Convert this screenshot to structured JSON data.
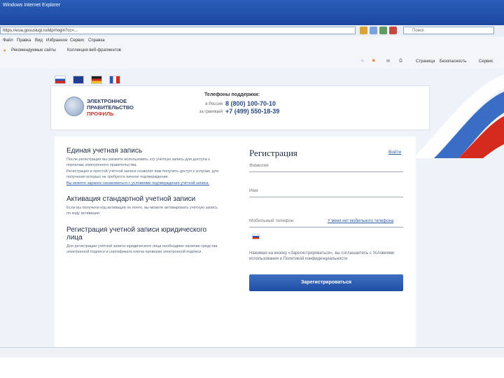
{
  "browser": {
    "title": "Windows Internet Explorer",
    "url": "https://esia.gosuslugi.ru/idp/rlogin?cc=...",
    "search_placeholder": "Поиск",
    "menu": [
      "Файл",
      "Правка",
      "Вид",
      "Избранное",
      "Сервис",
      "Справка"
    ],
    "favorites": [
      "Рекомендуемые сайты",
      "Коллекция веб-фрагментов"
    ],
    "commands": [
      "Страница",
      "Безопасность",
      "Сервис"
    ]
  },
  "header": {
    "languages": [
      "ru",
      "en",
      "de",
      "fr"
    ],
    "logo": [
      "ЭЛЕКТРОННОЕ",
      "ПРАВИТЕЛЬСТВО",
      "ПРОФИЛЬ"
    ],
    "support_title": "Телефоны поддержки:",
    "phone1_label": "в России",
    "phone1": "8 (800) 100-70-10",
    "phone2_label": "за границей",
    "phone2": "+7 (499) 550-18-39"
  },
  "left": {
    "section1_title": "Единая учетная запись",
    "section1_text": "После регистрации вы сможете использовать эту учётную запись для доступа к порталам электронного правительства.",
    "section1_text2": "Регистрация и простой учётной записи позволит вам получить доступ к услугам, для получения которых не требуется личное подтверждение.",
    "section1_link": "Вы можете заранее ознакомиться с условиями подтверждения учётной записи.",
    "section2_title": "Активация стандартной учетной записи",
    "section2_text": "Если вы получили код активации по почте, вы можете активировать учётную запись по коду активации.",
    "section3_title": "Регистрация учетной записи юридического лица",
    "section3_text": "Для регистрации учётной записи юридического лица необходимо наличие средства электронной подписи и сертификата ключа проверки электронной подписи."
  },
  "form": {
    "title": "Регистрация",
    "login_link": "Войти",
    "lastname_placeholder": "Фамилия",
    "firstname_placeholder": "Имя",
    "phone_placeholder": "Мобильный телефон",
    "no_phone_link": "У меня нет мобильного телефона",
    "terms_text": "Нажимая на кнопку «Зарегистрироваться», вы соглашаетесь с Условиями использования и Политикой конфиденциальности",
    "submit_label": "Зарегистрироваться"
  },
  "colors": {
    "accent": "#2b5ca6",
    "button": "#2a5bb0",
    "flag_red": "#d52b1e"
  }
}
